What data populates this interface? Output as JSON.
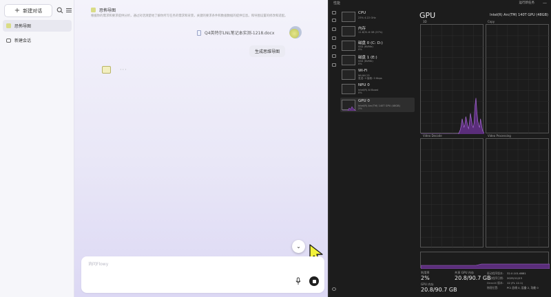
{
  "chat": {
    "sidebar": {
      "new_chat": "新建对话",
      "items": [
        {
          "label": "恐怖导图"
        },
        {
          "label": "新建会话"
        }
      ]
    },
    "main": {
      "conversation_title": "恐怖导图",
      "conversation_desc": "根据你的需求和要求提供分析，通过对话清楚地了解你所写任务的需求和背景，关键的要求条件和数据数据的提供信息。和导图设置的修改和适配。",
      "file_name": "Q4英特尔LNL笔记本实测-1218.docx",
      "user_message": "生成思维导图",
      "typing": "···",
      "scroll_down": "⌄",
      "input_placeholder": "询问Flowy"
    }
  },
  "task_manager": {
    "title": "性能",
    "run_task": "运行新任务",
    "window_controls": [
      "—",
      "□",
      "✕"
    ],
    "devices": [
      {
        "name": "CPU",
        "sub": "23% 4.22 GHz"
      },
      {
        "name": "内存",
        "sub": "11.8/31.6 GB (37%)"
      },
      {
        "name": "磁盘 0 (C: D:)",
        "sub": "SSD (NVMe)\n0%"
      },
      {
        "name": "磁盘 1 (E:)",
        "sub": "SSD (NVMe)\n0%"
      },
      {
        "name": "Wi-Fi",
        "sub": "WLAN 23\n发送: 0 接收: 0 Kbps"
      },
      {
        "name": "NPU 0",
        "sub": "Intel(R) AI Boost\n0%"
      },
      {
        "name": "GPU 0",
        "sub": "Intel(R) Arc(TM) 140T GPU (48GB)\n2%"
      }
    ],
    "gpu": {
      "heading": "GPU",
      "model": "Intel(R) Arc(TM) 140T GPU (48GB)",
      "graphs": [
        {
          "label": "3D"
        },
        {
          "label": "Copy"
        },
        {
          "label": "Video Decode"
        },
        {
          "label": "Video Processing"
        }
      ],
      "utilization_label": "利用率",
      "utilization_value": "2%",
      "shared_mem_label": "共享 GPU 内存",
      "shared_mem_value": "20.8/90.7 GB",
      "gpu_mem_label": "GPU 内存",
      "gpu_mem_value": "20.8/90.7 GB",
      "info": [
        {
          "k": "驱动程序版本:",
          "v": "32.0.101.6881"
        },
        {
          "k": "驱动程序日期:",
          "v": "2025/11/23"
        },
        {
          "k": "DirectX 版本:",
          "v": "12 (FL 12.1)"
        },
        {
          "k": "物理位置:",
          "v": "PCI 总线 0, 设备 2, 功能 0"
        }
      ]
    }
  },
  "colors": {
    "graph_line": "#a86bd6",
    "graph_fill": "#5a2d7a"
  },
  "chart_data": {
    "type": "area",
    "series": [
      {
        "values": [
          0,
          0,
          0,
          0,
          0,
          0,
          0,
          0,
          0,
          0,
          0,
          0,
          0,
          0,
          0,
          0,
          0,
          0,
          0,
          0,
          0,
          0,
          0,
          0,
          0,
          0,
          0,
          0,
          0,
          0,
          0,
          0,
          0,
          0,
          0,
          0,
          0,
          0,
          0,
          0,
          0,
          0,
          2,
          4,
          8,
          14,
          10,
          6,
          9,
          16,
          12,
          7,
          5,
          11,
          19,
          14,
          8,
          6,
          10,
          26,
          33,
          21,
          12,
          8,
          6,
          14,
          9,
          4,
          2,
          1
        ]
      }
    ],
    "ylim": [
      0,
      100
    ]
  }
}
